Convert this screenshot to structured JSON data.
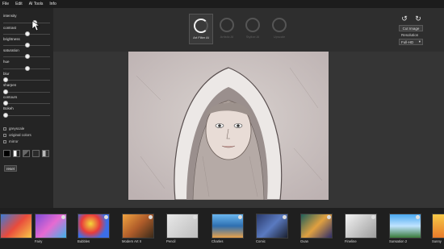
{
  "menu": [
    "File",
    "Edit",
    "AI Tools",
    "Info"
  ],
  "sliders": [
    {
      "label": "intensity",
      "level": 0.62
    },
    {
      "label": "contrast",
      "level": 0.55
    },
    {
      "label": "brightness",
      "level": 0.55
    },
    {
      "label": "saturation",
      "level": 0.55
    },
    {
      "label": "hue",
      "level": 0.55
    },
    {
      "label": "blur",
      "level": 0.0
    },
    {
      "label": "sharpen",
      "level": 0.0
    },
    {
      "label": "contours",
      "level": 0.0
    },
    {
      "label": "Bokeh",
      "level": 0.0
    }
  ],
  "checkboxes": [
    "greyscale",
    "original colors",
    "mirror"
  ],
  "reset_label": "reset",
  "filters": [
    {
      "label": "Art Filter AI",
      "active": true
    },
    {
      "label": "Artistic AI",
      "active": false
    },
    {
      "label": "Stylize AI",
      "active": false
    },
    {
      "label": "Upscale",
      "active": false
    }
  ],
  "right_panel": {
    "cut_label": "Cut Image",
    "resolution_label": "Resolution",
    "resolution_value": "Full-HD",
    "rotate_left_icon": "rotate-left-icon",
    "rotate_right_icon": "rotate-right-icon"
  },
  "thumbnails": [
    {
      "label": ""
    },
    {
      "label": "Fairy"
    },
    {
      "label": "Bubbles"
    },
    {
      "label": "Modern Art II"
    },
    {
      "label": "Pencil"
    },
    {
      "label": "Charles"
    },
    {
      "label": "Comic"
    },
    {
      "label": "Gvan"
    },
    {
      "label": "Fineline"
    },
    {
      "label": "Sunsation 2"
    },
    {
      "label": "Sunny"
    }
  ],
  "colors": {
    "accent": "#ffffff",
    "panel": "#242424",
    "background": "#2b2b2b"
  }
}
